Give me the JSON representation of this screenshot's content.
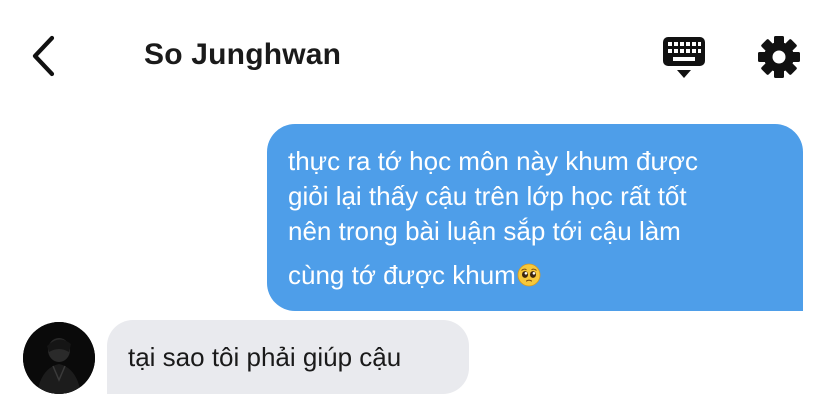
{
  "header": {
    "back_icon": "chevron-left-icon",
    "title": "So Junghwan",
    "keyboard_icon": "keyboard-icon",
    "settings_icon": "gear-icon"
  },
  "messages": [
    {
      "direction": "outgoing",
      "lines": [
        "thực ra tớ học môn này khum được",
        "giỏi lại thấy cậu trên lớp học rất tốt",
        "nên trong bài luận sắp tới cậu làm",
        "cùng tớ được khum"
      ],
      "emoji": "pleading-face-emoji",
      "bubble_color": "#4e9ee9"
    },
    {
      "direction": "incoming",
      "text": "tại sao tôi phải giúp cậu",
      "bubble_color": "#e9eaee"
    }
  ]
}
